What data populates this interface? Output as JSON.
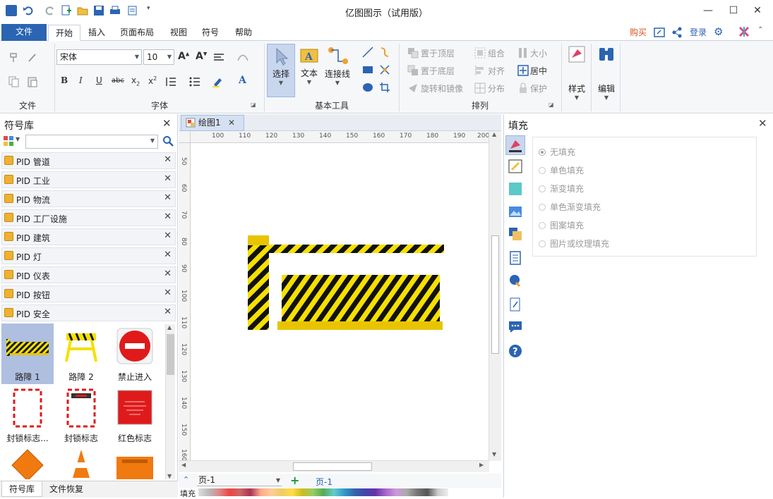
{
  "window": {
    "title": "亿图图示（试用版）",
    "controls": {
      "minimize": "—",
      "maximize": "☐",
      "close": "✕"
    }
  },
  "menu": {
    "tabs": [
      "文件",
      "开始",
      "插入",
      "页面布局",
      "视图",
      "符号",
      "帮助"
    ],
    "active": "开始",
    "right": {
      "buy": "购买",
      "login": "登录"
    }
  },
  "ribbon": {
    "groups": [
      "文件",
      "字体",
      "基本工具",
      "排列"
    ],
    "font": {
      "family": "宋体",
      "size": "10"
    },
    "tools": {
      "select": "选择",
      "text": "文本",
      "connector": "连接线"
    },
    "arrange": {
      "bring_front": "置于顶层",
      "send_back": "置于底层",
      "rotate_mirror": "旋转和镜像",
      "group": "组合",
      "align": "对齐",
      "distribute": "分布",
      "size": "大小",
      "center": "居中",
      "protect": "保护"
    },
    "style_label": "样式",
    "edit_label": "编辑"
  },
  "library": {
    "title": "符号库",
    "categories": [
      "PID 管道",
      "PID 工业",
      "PID 物流",
      "PID 工厂设施",
      "PID 建筑",
      "PID 灯",
      "PID 仪表",
      "PID 按钮",
      "PID 安全"
    ],
    "symbols": [
      {
        "label": "路障 1",
        "selected": true
      },
      {
        "label": "路障 2",
        "selected": false
      },
      {
        "label": "禁止进入",
        "selected": false
      },
      {
        "label": "封锁标志...",
        "selected": false
      },
      {
        "label": "封锁标志",
        "selected": false
      },
      {
        "label": "红色标志",
        "selected": false
      }
    ],
    "bottom_tabs": [
      "符号库",
      "文件恢复"
    ]
  },
  "document": {
    "tab": "绘图1",
    "ruler_h": [
      "100",
      "110",
      "120",
      "130",
      "140",
      "150",
      "160",
      "170",
      "180",
      "190",
      "200"
    ],
    "ruler_v": [
      "50",
      "60",
      "70",
      "80",
      "90",
      "100",
      "110",
      "120",
      "130",
      "140",
      "150",
      "160"
    ],
    "page_selector": "页-1",
    "page_tab": "页-1",
    "color_bar_label": "填充"
  },
  "fill_panel": {
    "title": "填充",
    "options": [
      "无填充",
      "单色填充",
      "渐变填充",
      "单色渐变填充",
      "图案填充",
      "图片或纹理填充"
    ],
    "selected": "无填充"
  },
  "colors": {
    "accent": "#2b64b2",
    "hazard_yellow": "#f5e000",
    "hazard_black": "#111111",
    "base_yellow": "#e8c400"
  }
}
